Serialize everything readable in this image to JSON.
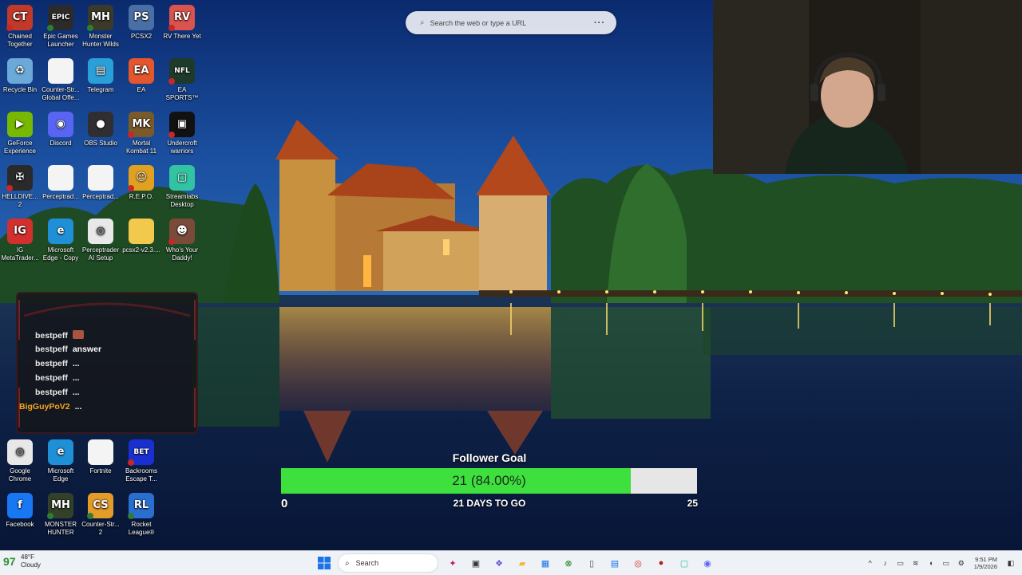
{
  "desktop": {
    "icons": [
      {
        "label": "Chained Together",
        "icon": "chained-together-icon",
        "color": "#c0392b",
        "glyph": "CT",
        "badge": "err"
      },
      {
        "label": "Epic Games Launcher",
        "icon": "epic-games-icon",
        "color": "#2b2b2b",
        "glyph": "EPIC",
        "badge": "ok"
      },
      {
        "label": "Monster Hunter Wilds",
        "icon": "monster-hunter-icon",
        "color": "#3b3a2a",
        "glyph": "MH",
        "badge": "ok"
      },
      {
        "label": "PCSX2",
        "icon": "pcsx2-icon",
        "color": "#4a6fa5",
        "glyph": "PS",
        "badge": ""
      },
      {
        "label": "RV There Yet",
        "icon": "rv-there-yet-icon",
        "color": "#d9534f",
        "glyph": "RV",
        "badge": "err"
      },
      {
        "label": "Recycle Bin",
        "icon": "recycle-bin-icon",
        "color": "#6aa9d8",
        "glyph": "♻",
        "badge": ""
      },
      {
        "label": "Counter-Str... Global Offe...",
        "icon": "file-icon",
        "color": "#f4f4f4",
        "glyph": "",
        "badge": ""
      },
      {
        "label": "Telegram",
        "icon": "telegram-icon",
        "color": "#2a9fd8",
        "glyph": "▤",
        "badge": ""
      },
      {
        "label": "EA",
        "icon": "ea-icon",
        "color": "#e4572e",
        "glyph": "EA",
        "badge": ""
      },
      {
        "label": "EA SPORTS™ Madden N...",
        "icon": "madden-icon",
        "color": "#1e3a2a",
        "glyph": "NFL",
        "badge": "err"
      },
      {
        "label": "GeForce Experience",
        "icon": "geforce-icon",
        "color": "#76b900",
        "glyph": "▶",
        "badge": ""
      },
      {
        "label": "Discord",
        "icon": "discord-icon",
        "color": "#5865f2",
        "glyph": "◉",
        "badge": ""
      },
      {
        "label": "OBS Studio",
        "icon": "obs-icon",
        "color": "#302e31",
        "glyph": "●",
        "badge": ""
      },
      {
        "label": "Mortal Kombat 11",
        "icon": "mortal-kombat-icon",
        "color": "#7a5a2a",
        "glyph": "MK",
        "badge": "err"
      },
      {
        "label": "Undercroft warriors",
        "icon": "undercroft-icon",
        "color": "#111111",
        "glyph": "▣",
        "badge": "err"
      },
      {
        "label": "HELLDIVE... 2",
        "icon": "helldivers-icon",
        "color": "#2a2a2a",
        "glyph": "✠",
        "badge": "err"
      },
      {
        "label": "Perceptrad...",
        "icon": "file-icon",
        "color": "#f4f4f4",
        "glyph": "",
        "badge": ""
      },
      {
        "label": "Perceptrad...",
        "icon": "file-icon",
        "color": "#f4f4f4",
        "glyph": "",
        "badge": ""
      },
      {
        "label": "R.E.P.O.",
        "icon": "repo-icon",
        "color": "#e0a020",
        "glyph": "☺",
        "badge": "err"
      },
      {
        "label": "Streamlabs Desktop",
        "icon": "streamlabs-icon",
        "color": "#31c3a2",
        "glyph": "▢",
        "badge": ""
      },
      {
        "label": "IG MetaTrader...",
        "icon": "ig-metatrader-icon",
        "color": "#d32f2f",
        "glyph": "IG",
        "badge": ""
      },
      {
        "label": "Microsoft Edge - Copy",
        "icon": "edge-icon",
        "color": "#1f8fd6",
        "glyph": "e",
        "badge": ""
      },
      {
        "label": "Perceptrader AI Setup Gu...",
        "icon": "chrome-icon",
        "color": "#e8e8e8",
        "glyph": "◎",
        "badge": ""
      },
      {
        "label": "pcsx2-v2.3....",
        "icon": "folder-icon",
        "color": "#f2c94c",
        "glyph": "",
        "badge": ""
      },
      {
        "label": "Who's Your Daddy!",
        "icon": "whos-your-daddy-icon",
        "color": "#7a4a3a",
        "glyph": "☻",
        "badge": "err"
      },
      {
        "label": "Google Chrome",
        "icon": "chrome-icon",
        "color": "#e8e8e8",
        "glyph": "◎",
        "badge": ""
      },
      {
        "label": "Microsoft Edge",
        "icon": "edge-icon",
        "color": "#1f8fd6",
        "glyph": "e",
        "badge": ""
      },
      {
        "label": "Fortnite",
        "icon": "file-icon",
        "color": "#f4f4f4",
        "glyph": "",
        "badge": ""
      },
      {
        "label": "Backrooms Escape T...",
        "icon": "backrooms-icon",
        "color": "#1a2fd0",
        "glyph": "BET",
        "badge": "err"
      },
      {
        "label": "Facebook",
        "icon": "facebook-icon",
        "color": "#1877f2",
        "glyph": "f",
        "badge": ""
      },
      {
        "label": "MONSTER HUNTER RI...",
        "icon": "monster-hunter-rise-icon",
        "color": "#33402a",
        "glyph": "MH",
        "badge": "ok"
      },
      {
        "label": "Counter-Str... 2",
        "icon": "counter-strike-icon",
        "color": "#e39b2a",
        "glyph": "CS",
        "badge": "ok"
      },
      {
        "label": "Rocket League®",
        "icon": "rocket-league-icon",
        "color": "#2a6fd0",
        "glyph": "RL",
        "badge": "ok"
      }
    ]
  },
  "browser_search": {
    "placeholder": "Search the web or type a URL",
    "more": "···"
  },
  "chat": {
    "messages": [
      {
        "user": "bestpeff",
        "text": "",
        "emote": true,
        "highlight": false
      },
      {
        "user": "bestpeff",
        "text": "answer",
        "emote": false,
        "highlight": false
      },
      {
        "user": "bestpeff",
        "text": "...",
        "emote": false,
        "highlight": false
      },
      {
        "user": "bestpeff",
        "text": "...",
        "emote": false,
        "highlight": false
      },
      {
        "user": "bestpeff",
        "text": "...",
        "emote": false,
        "highlight": false
      },
      {
        "user": "BigGuyPoV2",
        "text": "...",
        "emote": false,
        "highlight": true
      }
    ],
    "highlight_color": "#f5a623"
  },
  "follower_goal": {
    "title": "Follower Goal",
    "value_text": "21 (84.00%)",
    "progress": 0.84,
    "min": "0",
    "max": "25",
    "days_left": "21 DAYS TO GO",
    "fill_color": "#3ee03e"
  },
  "taskbar": {
    "weather_temp": "48°F",
    "weather_cond": "Cloudy",
    "weather_badge": "97",
    "search_label": "Search",
    "time": "9:51 PM",
    "date": "1/9/2026",
    "pinned": [
      "start-icon",
      "search",
      "copilot-icon",
      "task-view-icon",
      "widgets-icon",
      "file-explorer-icon",
      "store-icon",
      "xbox-icon",
      "notepad-icon",
      "notification-app-icon",
      "chrome-icon",
      "photos-app-icon",
      "streamlabs-icon",
      "discord-icon"
    ]
  }
}
